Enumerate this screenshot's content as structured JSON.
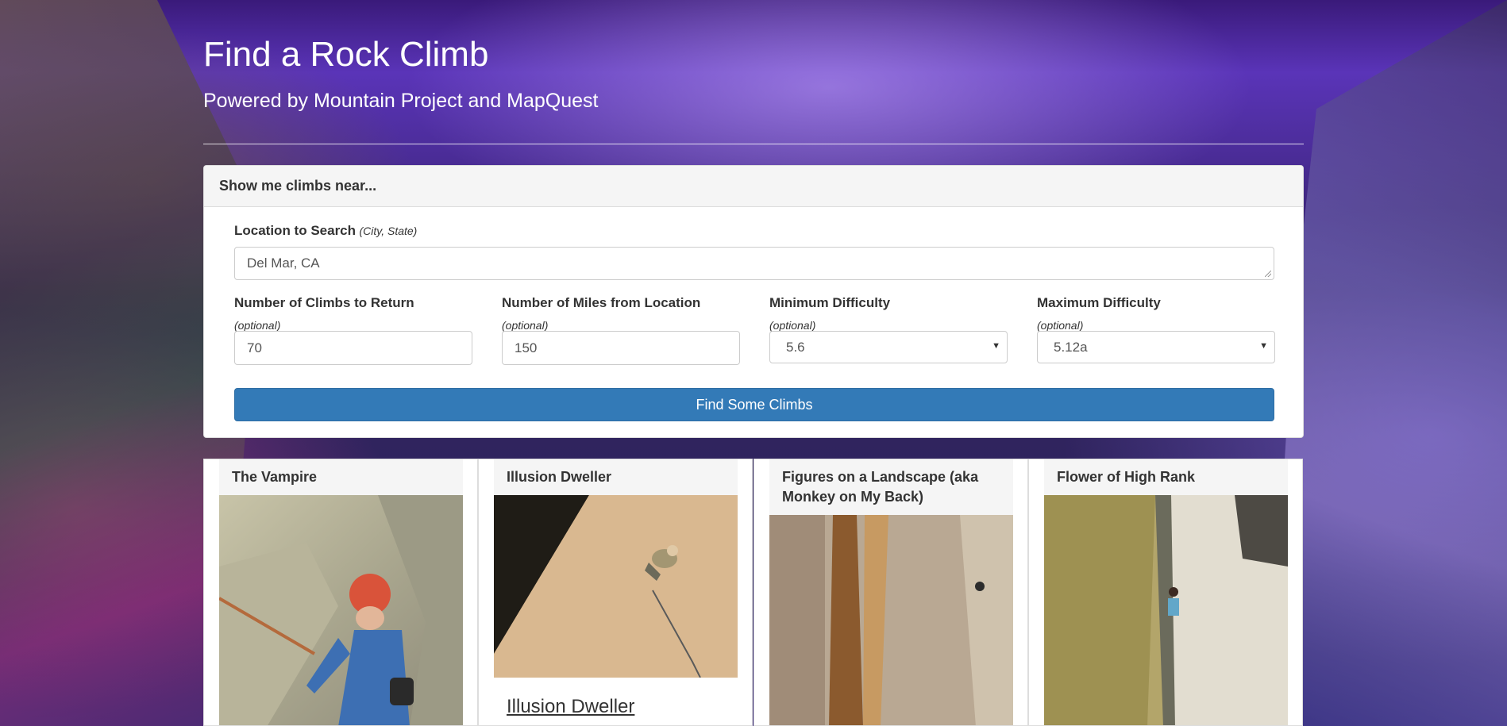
{
  "header": {
    "title": "Find a Rock Climb",
    "subtitle": "Powered by Mountain Project and MapQuest"
  },
  "search_panel": {
    "heading": "Show me climbs near...",
    "location": {
      "label": "Location to Search",
      "hint": "(City, State)",
      "value": "Del Mar, CA"
    },
    "num_climbs": {
      "label": "Number of Climbs to Return",
      "hint": "(optional)",
      "value": "70"
    },
    "num_miles": {
      "label": "Number of Miles from Location",
      "hint": "(optional)",
      "value": "150"
    },
    "min_difficulty": {
      "label": "Minimum Difficulty",
      "hint": "(optional)",
      "value": "5.6"
    },
    "max_difficulty": {
      "label": "Maximum Difficulty",
      "hint": "(optional)",
      "value": "5.12a"
    },
    "submit_label": "Find Some Climbs"
  },
  "results": [
    {
      "name": "The Vampire"
    },
    {
      "name": "Illusion Dweller",
      "link_text": "Illusion Dweller"
    },
    {
      "name": "Figures on a Landscape (aka Monkey on My Back)"
    },
    {
      "name": "Flower of High Rank"
    }
  ],
  "colors": {
    "primary_button": "#337ab7",
    "panel_heading_bg": "#f5f5f5"
  },
  "icons": {
    "select_caret": "caret-down-icon"
  }
}
